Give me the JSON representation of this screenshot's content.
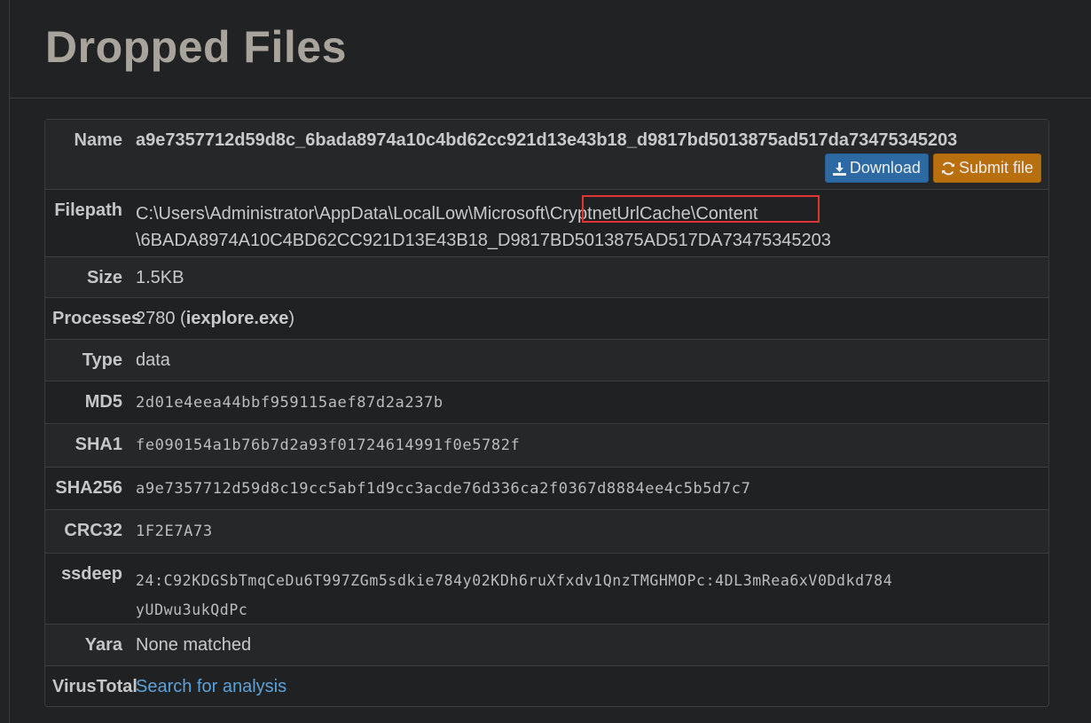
{
  "page": {
    "title": "Dropped Files"
  },
  "file": {
    "name_label": "Name",
    "name": "a9e7357712d59d8c_6bada8974a10c4bd62cc921d13e43b18_d9817bd5013875ad517da73475345203",
    "download_label": "Download",
    "submit_label": "Submit file",
    "filepath_label": "Filepath",
    "filepath_line1": "C:\\Users\\Administrator\\AppData\\LocalLow\\Microsoft\\CryptnetUrlCache\\Content",
    "filepath_line2": "\\6BADA8974A10C4BD62CC921D13E43B18_D9817BD5013875AD517DA73475345203",
    "size_label": "Size",
    "size": "1.5KB",
    "processes_label": "Processes",
    "process_pid": "2780",
    "process_name": "iexplore.exe",
    "type_label": "Type",
    "type": "data",
    "md5_label": "MD5",
    "md5": "2d01e4eea44bbf959115aef87d2a237b",
    "sha1_label": "SHA1",
    "sha1": "fe090154a1b76b7d2a93f01724614991f0e5782f",
    "sha256_label": "SHA256",
    "sha256": "a9e7357712d59d8c19cc5abf1d9cc3acde76d336ca2f0367d8884ee4c5b5d7c7",
    "crc32_label": "CRC32",
    "crc32": "1F2E7A73",
    "ssdeep_label": "ssdeep",
    "ssdeep_line1": "24:C92KDGSbTmqCeDu6T997ZGm5sdkie784y02KDh6ruXfxdv1QnzTMGHMOPc:4DL3mRea6xV0Ddkd784",
    "ssdeep_line2": "yUDwu3ukQdPc",
    "yara_label": "Yara",
    "yara": "None matched",
    "virustotal_label": "VirusTotal",
    "virustotal_link": "Search for analysis"
  },
  "colors": {
    "highlight_box": "#e03535",
    "download_button": "#2d6aa3",
    "submit_button": "#b8700e",
    "link": "#5ea1d6"
  },
  "icons": {
    "download": "download-icon",
    "submit": "refresh-icon"
  }
}
